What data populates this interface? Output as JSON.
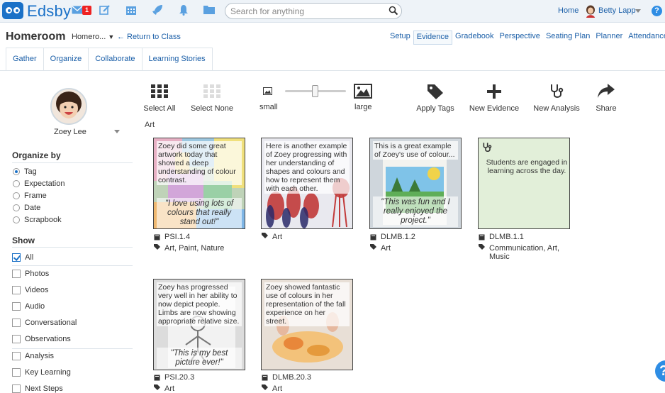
{
  "topbar": {
    "brand": "Edsby",
    "mail_badge": "1",
    "search_placeholder": "Search for anything",
    "home": "Home",
    "user": "Betty Lapp",
    "help": "?"
  },
  "header": {
    "title": "Homeroom",
    "class_select": "Homero...",
    "return": "← Return to Class"
  },
  "main_nav": [
    "Setup",
    "Evidence",
    "Gradebook",
    "Perspective",
    "Seating Plan",
    "Planner",
    "Attendance"
  ],
  "main_nav_active": "Evidence",
  "subtabs": [
    "Gather",
    "Organize",
    "Collaborate",
    "Learning Stories"
  ],
  "student": {
    "name": "Zoey Lee"
  },
  "organize": {
    "title": "Organize by",
    "options": [
      "Tag",
      "Expectation",
      "Frame",
      "Date",
      "Scrapbook"
    ],
    "selected": "Tag"
  },
  "show": {
    "title": "Show",
    "options": [
      "All",
      "Photos",
      "Videos",
      "Audio",
      "Conversational",
      "Observations",
      "Analysis",
      "Key Learning",
      "Next Steps"
    ],
    "checked": [
      "All"
    ]
  },
  "toolbar": {
    "select_all": "Select All",
    "select_none": "Select None",
    "small": "small",
    "large": "large",
    "apply_tags": "Apply Tags",
    "new_evidence": "New Evidence",
    "new_analysis": "New Analysis",
    "share": "Share",
    "size_level": 0.5
  },
  "group_label": "Art",
  "cards": [
    {
      "caption": "Zoey did some great artwork today that showed a deep understanding of colour contrast.",
      "quote": "\"I love using lots of colours that really stand out!\"",
      "code": "PSI.1.4",
      "tags": "Art, Paint, Nature"
    },
    {
      "caption": "Here is another example of Zoey progressing with her understanding of shapes and colours and how to represent them with each other.",
      "quote": "",
      "code": "",
      "tags": "Art"
    },
    {
      "caption": "This is a great example of Zoey's use of colour...",
      "quote": "\"This was fun and I really enjoyed the project.\"",
      "code": "DLMB.1.2",
      "tags": "Art"
    },
    {
      "caption": "Students are engaged in learning across the day.",
      "quote": "",
      "code": "DLMB.1.1",
      "tags": "Communication, Art, Music"
    },
    {
      "caption": "Zoey has progressed very well in her ability to now depict people. Limbs are now showing appropriate relative size.",
      "quote": "\"This is my best picture ever!\"",
      "code": "PSI.20.3",
      "tags": "Art"
    },
    {
      "caption": "Zoey showed fantastic use of colours in her representation of the fall experience on her street.",
      "quote": "",
      "code": "DLMB.20.3",
      "tags": "Art"
    }
  ],
  "colors": {
    "brand": "#1b71c7",
    "link": "#1b5fa8",
    "observation_bg": "#e2efd9"
  }
}
